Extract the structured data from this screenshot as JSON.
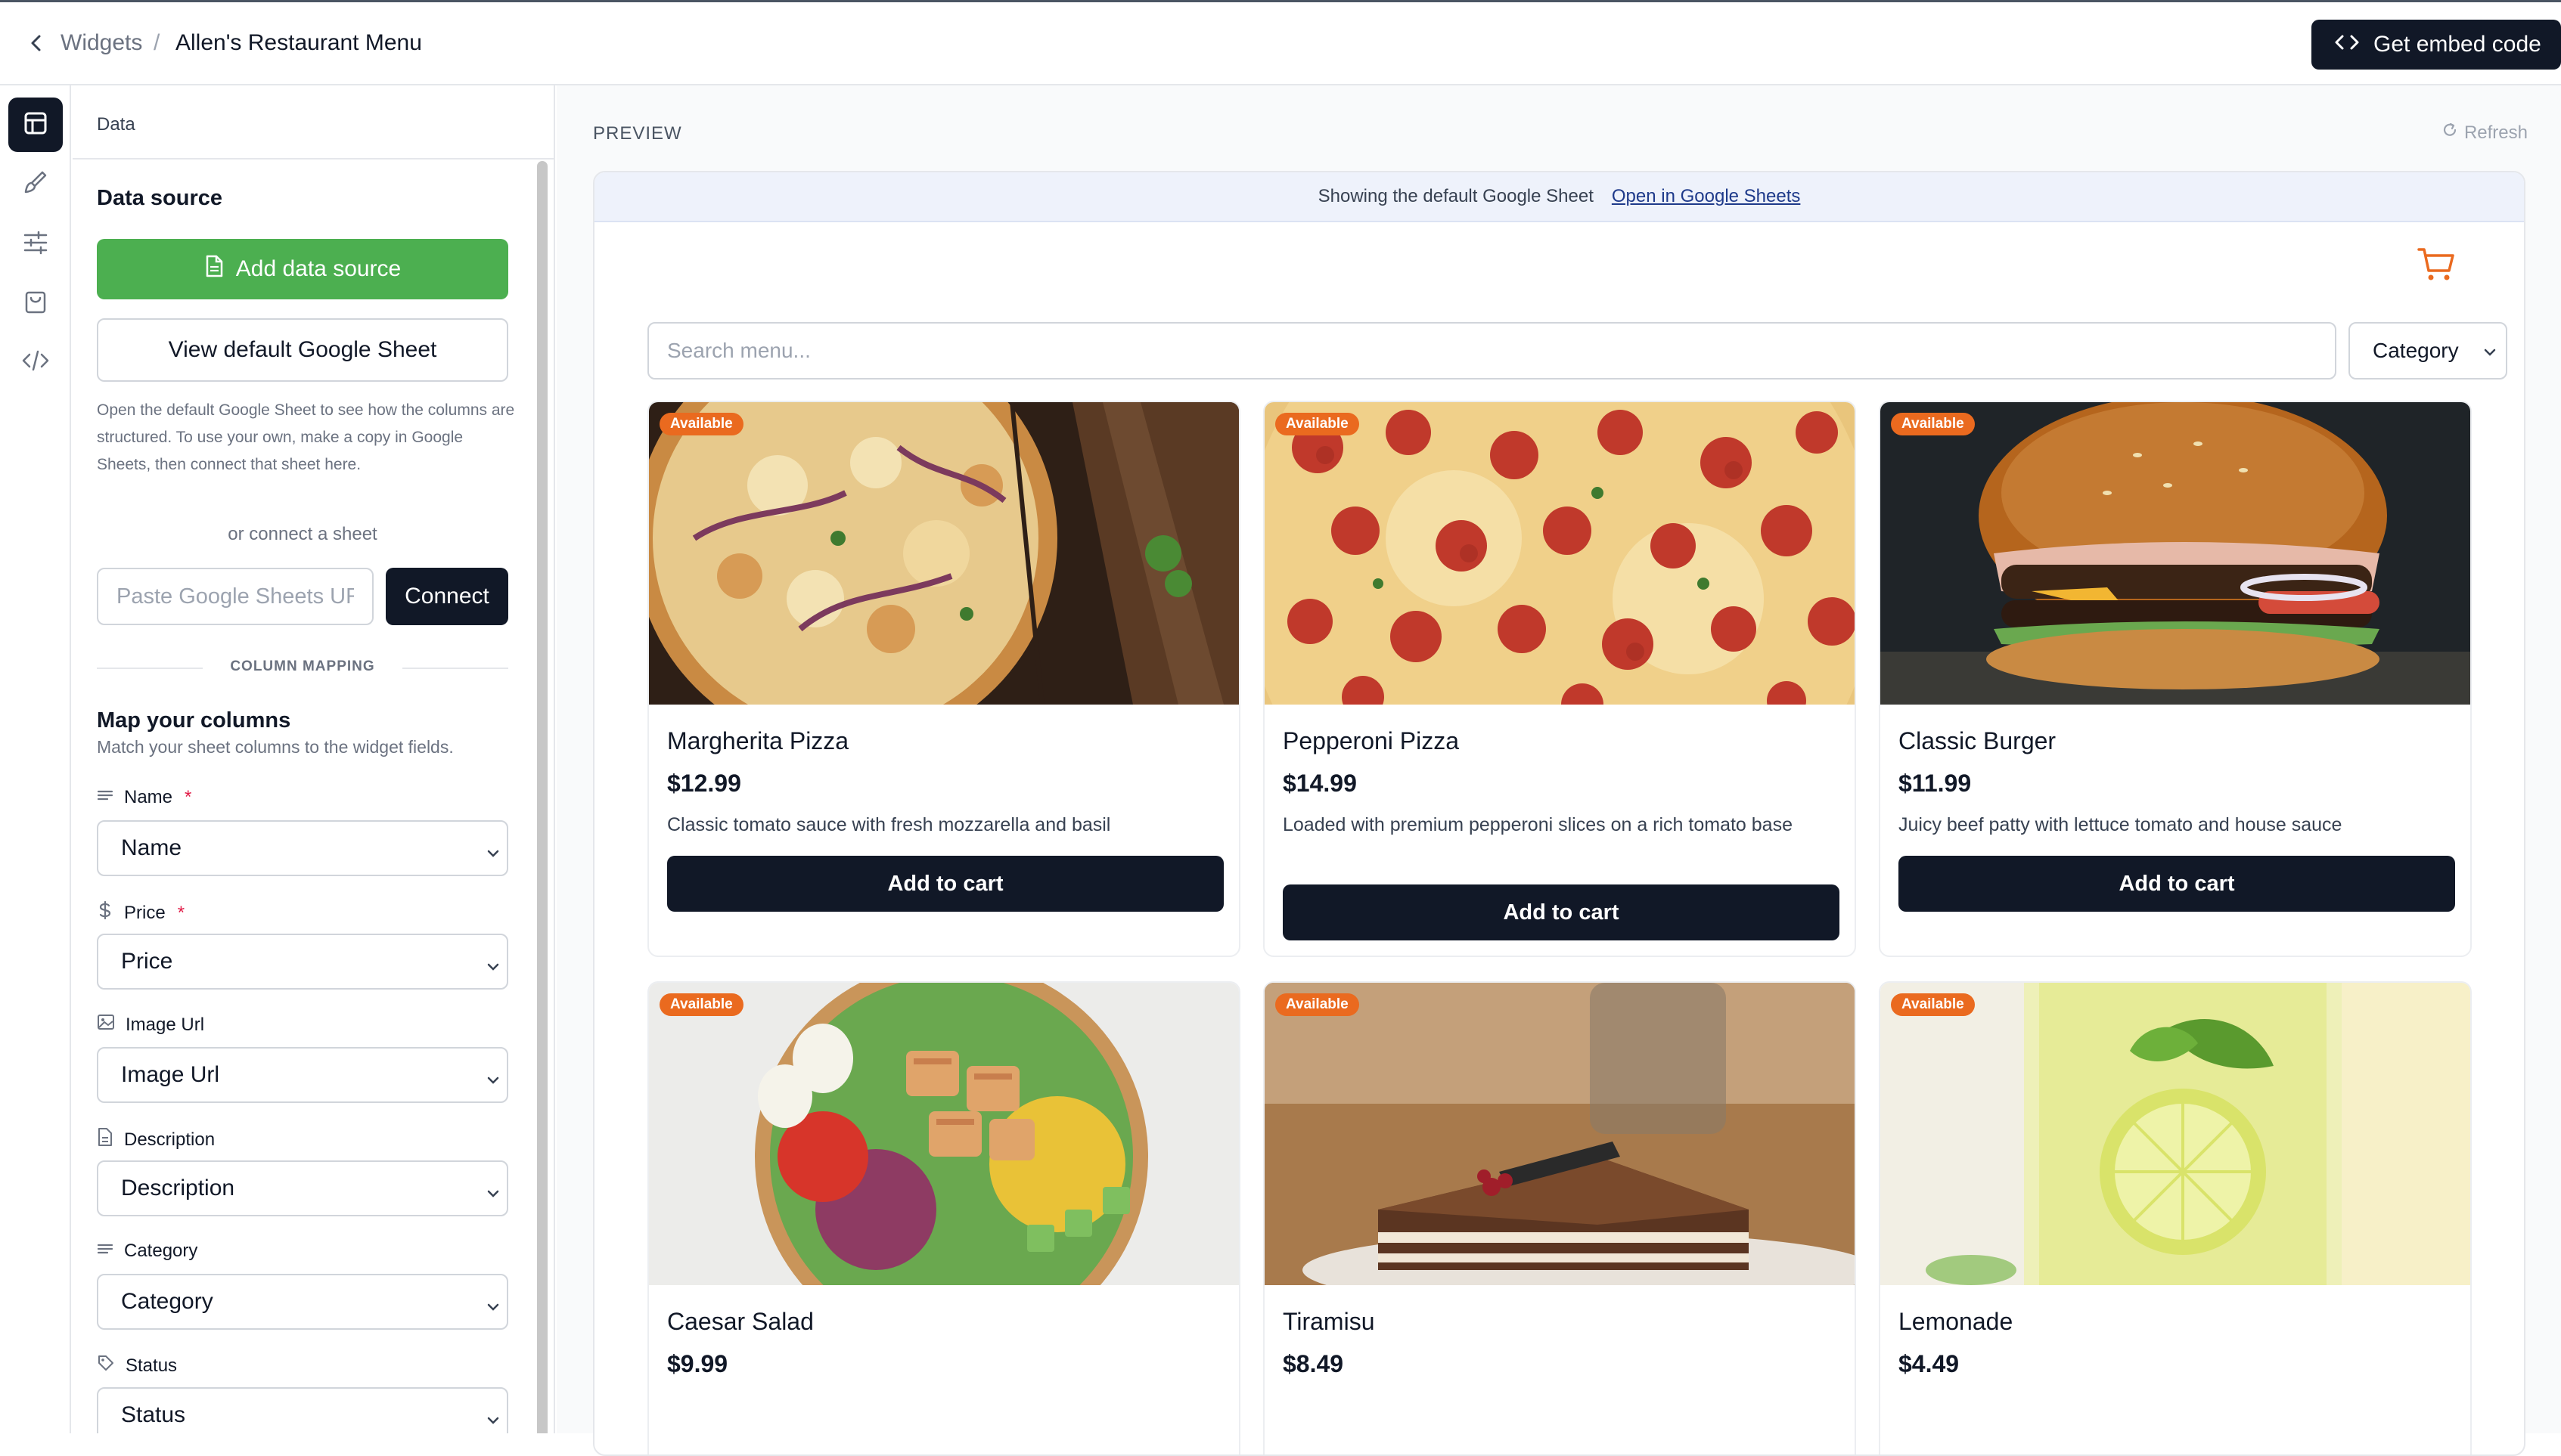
{
  "header": {
    "breadcrumb_parent": "Widgets",
    "breadcrumb_sep": "/",
    "breadcrumb_current": "Allen's Restaurant Menu",
    "embed_label": "Get embed code"
  },
  "rail": {
    "items": [
      {
        "icon": "table-icon",
        "active": true
      },
      {
        "icon": "paintbrush-icon",
        "active": false
      },
      {
        "icon": "sliders-icon",
        "active": false
      },
      {
        "icon": "shopping-bag-icon",
        "active": false
      },
      {
        "icon": "code-icon",
        "active": false
      }
    ]
  },
  "panel": {
    "header": "Data",
    "data_source_title": "Data source",
    "add_data_source": "Add data source",
    "view_default": "View default Google Sheet",
    "help_text": "Open the default Google Sheet to see how the columns are structured. To use your own, make a copy in Google Sheets, then connect that sheet here.",
    "or_connect": "or connect a sheet",
    "url_placeholder": "Paste Google Sheets URL",
    "connect_label": "Connect",
    "column_mapping": "COLUMN MAPPING",
    "map_title": "Map your columns",
    "map_subtitle": "Match your sheet columns to the widget fields.",
    "fields": [
      {
        "label": "Name",
        "required": "*",
        "value": "Name",
        "icon": "lines-icon"
      },
      {
        "label": "Price",
        "required": "*",
        "value": "Price",
        "icon": "dollar-icon"
      },
      {
        "label": "Image Url",
        "required": "",
        "value": "Image Url",
        "icon": "image-icon"
      },
      {
        "label": "Description",
        "required": "",
        "value": "Description",
        "icon": "document-icon"
      },
      {
        "label": "Category",
        "required": "",
        "value": "Category",
        "icon": "lines-icon"
      },
      {
        "label": "Status",
        "required": "",
        "value": "Status",
        "icon": "tag-icon"
      }
    ]
  },
  "preview": {
    "label": "PREVIEW",
    "refresh": "Refresh",
    "banner_text": "Showing the default Google Sheet",
    "banner_link": "Open in Google Sheets",
    "search_placeholder": "Search menu...",
    "category_label": "Category",
    "accent_color": "#ea6a1f",
    "items": [
      {
        "badge": "Available",
        "name": "Margherita Pizza",
        "price": "$12.99",
        "description": "Classic tomato sauce with fresh mozzarella and basil",
        "button": "Add to cart"
      },
      {
        "badge": "Available",
        "name": "Pepperoni Pizza",
        "price": "$14.99",
        "description": "Loaded with premium pepperoni slices on a rich tomato base",
        "button": "Add to cart"
      },
      {
        "badge": "Available",
        "name": "Classic Burger",
        "price": "$11.99",
        "description": "Juicy beef patty with lettuce tomato and house sauce",
        "button": "Add to cart"
      },
      {
        "badge": "Available",
        "name": "Caesar Salad",
        "price": "$9.99"
      },
      {
        "badge": "Available",
        "name": "Tiramisu",
        "price": "$8.49"
      },
      {
        "badge": "Available",
        "name": "Lemonade",
        "price": "$4.49"
      }
    ]
  }
}
